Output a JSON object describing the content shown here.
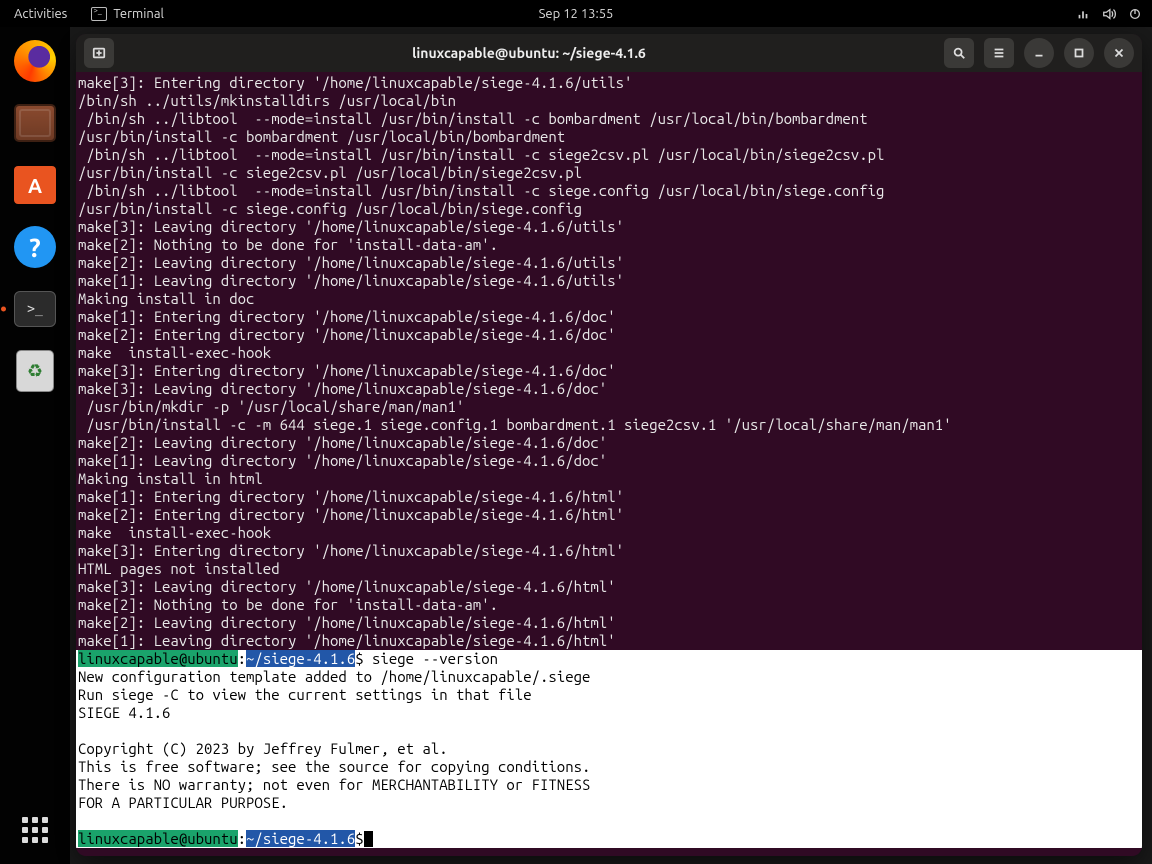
{
  "topbar": {
    "activities": "Activities",
    "active_app": "Terminal",
    "clock": "Sep 12  13:55"
  },
  "dock": {
    "items": [
      {
        "name": "firefox",
        "label": "Firefox"
      },
      {
        "name": "files",
        "label": "Files"
      },
      {
        "name": "software",
        "label": "Ubuntu Software"
      },
      {
        "name": "help",
        "label": "Help"
      },
      {
        "name": "terminal",
        "label": "Terminal",
        "active": true
      },
      {
        "name": "trash",
        "label": "Trash"
      }
    ],
    "apps_button": "Show Applications"
  },
  "window": {
    "title": "linuxcapable@ubuntu: ~/siege-4.1.6"
  },
  "prompt": {
    "user_host": "linuxcapable@ubuntu",
    "sep": ":",
    "path": "~/siege-4.1.6",
    "dollar": "$"
  },
  "commands": {
    "cmd1": " siege --version",
    "cmd2": ""
  },
  "output": {
    "lines": [
      "make[3]: Entering directory '/home/linuxcapable/siege-4.1.6/utils'",
      "/bin/sh ../utils/mkinstalldirs /usr/local/bin",
      " /bin/sh ../libtool  --mode=install /usr/bin/install -c bombardment /usr/local/bin/bombardment",
      "/usr/bin/install -c bombardment /usr/local/bin/bombardment",
      " /bin/sh ../libtool  --mode=install /usr/bin/install -c siege2csv.pl /usr/local/bin/siege2csv.pl",
      "/usr/bin/install -c siege2csv.pl /usr/local/bin/siege2csv.pl",
      " /bin/sh ../libtool  --mode=install /usr/bin/install -c siege.config /usr/local/bin/siege.config",
      "/usr/bin/install -c siege.config /usr/local/bin/siege.config",
      "make[3]: Leaving directory '/home/linuxcapable/siege-4.1.6/utils'",
      "make[2]: Nothing to be done for 'install-data-am'.",
      "make[2]: Leaving directory '/home/linuxcapable/siege-4.1.6/utils'",
      "make[1]: Leaving directory '/home/linuxcapable/siege-4.1.6/utils'",
      "Making install in doc",
      "make[1]: Entering directory '/home/linuxcapable/siege-4.1.6/doc'",
      "make[2]: Entering directory '/home/linuxcapable/siege-4.1.6/doc'",
      "make  install-exec-hook",
      "make[3]: Entering directory '/home/linuxcapable/siege-4.1.6/doc'",
      "make[3]: Leaving directory '/home/linuxcapable/siege-4.1.6/doc'",
      " /usr/bin/mkdir -p '/usr/local/share/man/man1'",
      " /usr/bin/install -c -m 644 siege.1 siege.config.1 bombardment.1 siege2csv.1 '/usr/local/share/man/man1'",
      "make[2]: Leaving directory '/home/linuxcapable/siege-4.1.6/doc'",
      "make[1]: Leaving directory '/home/linuxcapable/siege-4.1.6/doc'",
      "Making install in html",
      "make[1]: Entering directory '/home/linuxcapable/siege-4.1.6/html'",
      "make[2]: Entering directory '/home/linuxcapable/siege-4.1.6/html'",
      "make  install-exec-hook",
      "make[3]: Entering directory '/home/linuxcapable/siege-4.1.6/html'",
      "HTML pages not installed",
      "make[3]: Leaving directory '/home/linuxcapable/siege-4.1.6/html'",
      "make[2]: Nothing to be done for 'install-data-am'.",
      "make[2]: Leaving directory '/home/linuxcapable/siege-4.1.6/html'",
      "make[1]: Leaving directory '/home/linuxcapable/siege-4.1.6/html'"
    ],
    "version_block": [
      "New configuration template added to /home/linuxcapable/.siege",
      "Run siege -C to view the current settings in that file",
      "SIEGE 4.1.6",
      "",
      "Copyright (C) 2023 by Jeffrey Fulmer, et al.",
      "This is free software; see the source for copying conditions.",
      "There is NO warranty; not even for MERCHANTABILITY or FITNESS",
      "FOR A PARTICULAR PURPOSE.",
      ""
    ]
  },
  "colors": {
    "term_bg": "#300a24",
    "prompt_user_bg": "#1aa36b",
    "prompt_path_bg": "#2257a8",
    "selection_bg": "#ffffff"
  }
}
